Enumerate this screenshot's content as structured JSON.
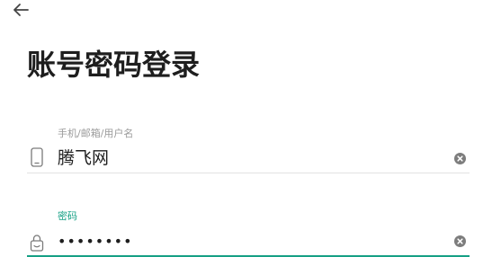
{
  "header": {
    "back_icon": "arrow-left-icon"
  },
  "title": "账号密码登录",
  "account": {
    "label": "手机/邮箱/用户名",
    "value": "腾飞网",
    "icon": "phone-icon",
    "clear_icon": "clear-circle-icon"
  },
  "password": {
    "label": "密码",
    "value": "••••••••",
    "icon": "lock-icon",
    "clear_icon": "clear-circle-icon"
  },
  "colors": {
    "accent": "#16a085",
    "text": "#1e1e1e",
    "muted": "#9a9a9a",
    "divider": "#e2e2e2"
  }
}
